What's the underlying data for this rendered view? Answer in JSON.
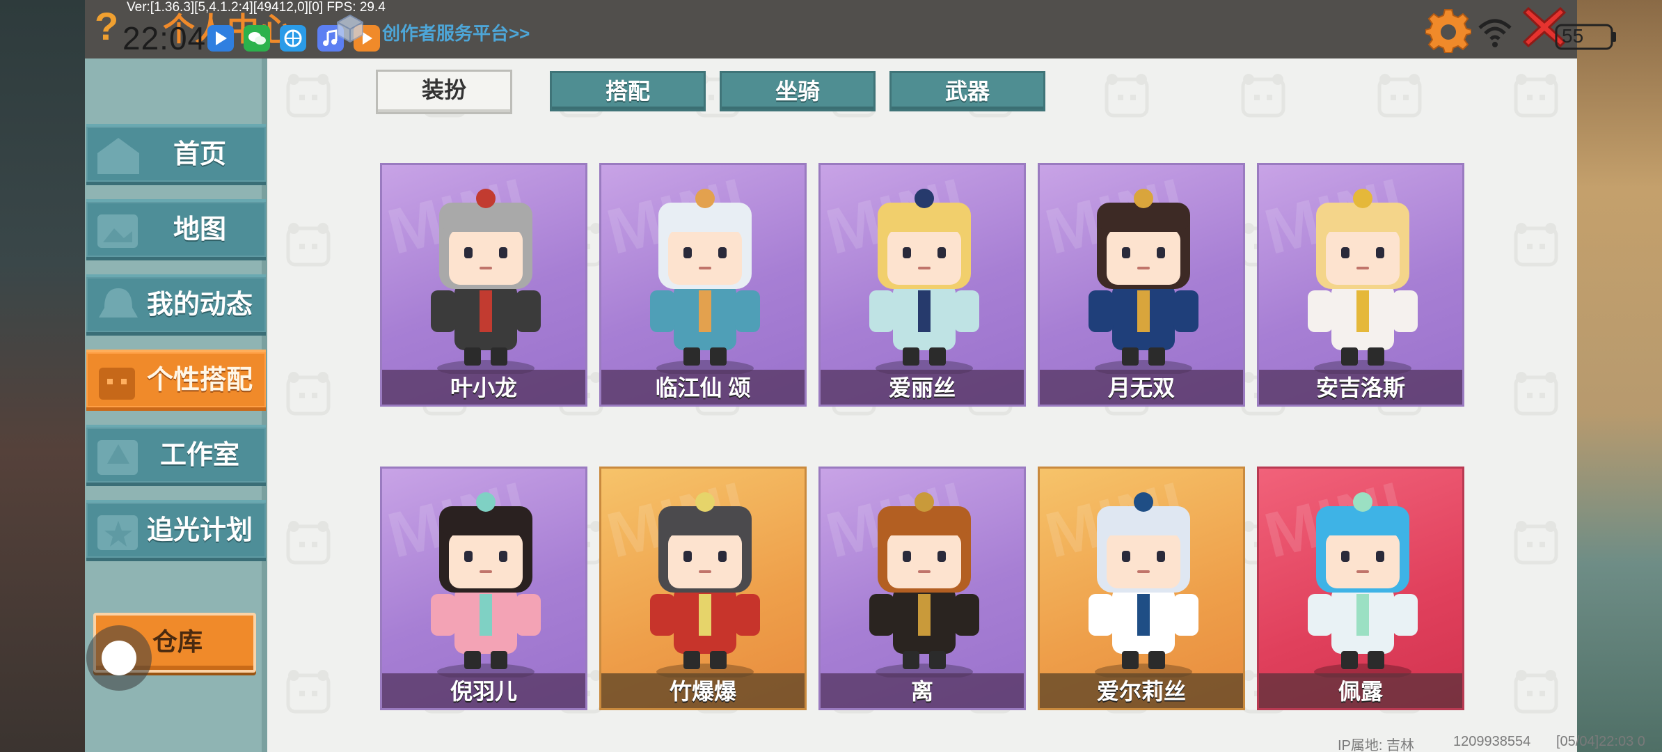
{
  "status_bar": {
    "debug": "Ver:[1.36.3][5,4.1.2:4][49412,0][0] FPS: 29.4",
    "time": "22:04",
    "battery": "55"
  },
  "header": {
    "title": "个人中心",
    "creator_link": "创作者服务平台>>"
  },
  "sidebar": {
    "items": [
      {
        "label": "首页",
        "icon": "home-icon"
      },
      {
        "label": "地图",
        "icon": "map-icon"
      },
      {
        "label": "我的动态",
        "icon": "bell-icon"
      },
      {
        "label": "个性搭配",
        "icon": "outfit-icon",
        "active": true
      },
      {
        "label": "工作室",
        "icon": "tree-icon"
      },
      {
        "label": "追光计划",
        "icon": "star-icon"
      }
    ],
    "warehouse_label": "仓库"
  },
  "tabs": [
    {
      "label": "装扮",
      "active": true
    },
    {
      "label": "搭配"
    },
    {
      "label": "坐骑"
    },
    {
      "label": "武器"
    }
  ],
  "cards": [
    {
      "name": "叶小龙",
      "theme": "purple",
      "hair": "#a9a9a9",
      "outfit": "#3b3b3b",
      "accent": "#c23b30"
    },
    {
      "name": "临江仙 颂",
      "theme": "purple",
      "hair": "#e8eef4",
      "outfit": "#4f9fb7",
      "accent": "#e3a14e"
    },
    {
      "name": "爱丽丝",
      "theme": "purple",
      "hair": "#f1cf6c",
      "outfit": "#bfe3e4",
      "accent": "#263a6c"
    },
    {
      "name": "月无双",
      "theme": "purple",
      "hair": "#3d2a25",
      "outfit": "#1f3f7a",
      "accent": "#d9a53c"
    },
    {
      "name": "安吉洛斯",
      "theme": "purple",
      "hair": "#f4d58a",
      "outfit": "#f5f1ee",
      "accent": "#e5b83a"
    },
    {
      "name": "倪羽儿",
      "theme": "purple",
      "hair": "#2a2120",
      "outfit": "#f3a3b5",
      "accent": "#7fd1c4"
    },
    {
      "name": "竹爆爆",
      "theme": "orange",
      "hair": "#4b4a4d",
      "outfit": "#c7342b",
      "accent": "#e6d46a"
    },
    {
      "name": "离",
      "theme": "purple",
      "hair": "#b35f22",
      "outfit": "#2a2420",
      "accent": "#c99a3a"
    },
    {
      "name": "爱尔莉丝",
      "theme": "orange",
      "hair": "#dfe7f2",
      "outfit": "#ffffff",
      "accent": "#1f4e85"
    },
    {
      "name": "佩露",
      "theme": "red",
      "hair": "#3eb3e6",
      "outfit": "#e9f2f5",
      "accent": "#9be0c3"
    }
  ],
  "card_watermark": "MINI",
  "footer": {
    "ip": "IP属地: 吉林",
    "uid": "1209938554",
    "timestamp": "[05/04]22:03 0"
  },
  "colors": {
    "accent_orange": "#f08a2a",
    "tab_teal": "#4f8e92",
    "sidebar_teal": "#4e8e98"
  }
}
